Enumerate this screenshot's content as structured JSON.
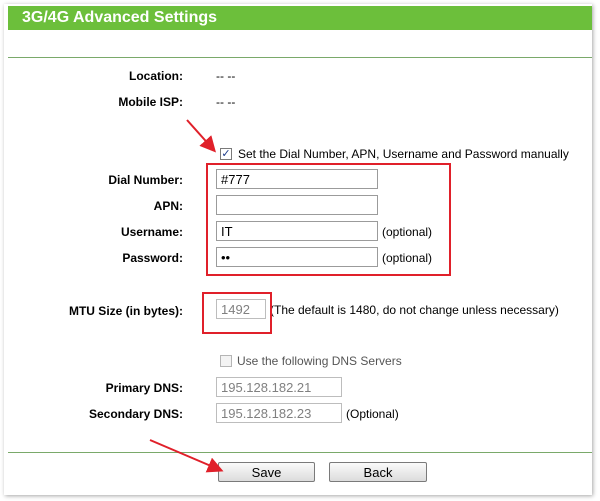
{
  "header": {
    "title": "3G/4G Advanced Settings"
  },
  "info": {
    "location_label": "Location:",
    "location_value": "-- --",
    "isp_label": "Mobile ISP:",
    "isp_value": "-- --"
  },
  "manual": {
    "checkbox_label": "Set the Dial Number, APN, Username and Password manually",
    "checked": true,
    "check_glyph": "✓"
  },
  "form": {
    "dial_label": "Dial Number:",
    "dial_value": "#777",
    "apn_label": "APN:",
    "apn_value": "",
    "username_label": "Username:",
    "username_value": "IT",
    "username_note": "(optional)",
    "password_label": "Password:",
    "password_value": "ab",
    "password_note": "(optional)"
  },
  "mtu": {
    "label": "MTU Size (in bytes):",
    "value": "1492",
    "note": "(The default is 1480, do not change unless necessary)"
  },
  "dns": {
    "checkbox_label": "Use the following DNS Servers",
    "checked": false,
    "primary_label": "Primary DNS:",
    "primary_value": "195.128.182.21",
    "secondary_label": "Secondary DNS:",
    "secondary_value": "195.128.182.23",
    "secondary_note": "(Optional)"
  },
  "buttons": {
    "save": "Save",
    "back": "Back"
  },
  "colors": {
    "header_bg": "#6cbf3b",
    "annotation_red": "#e0202a"
  }
}
